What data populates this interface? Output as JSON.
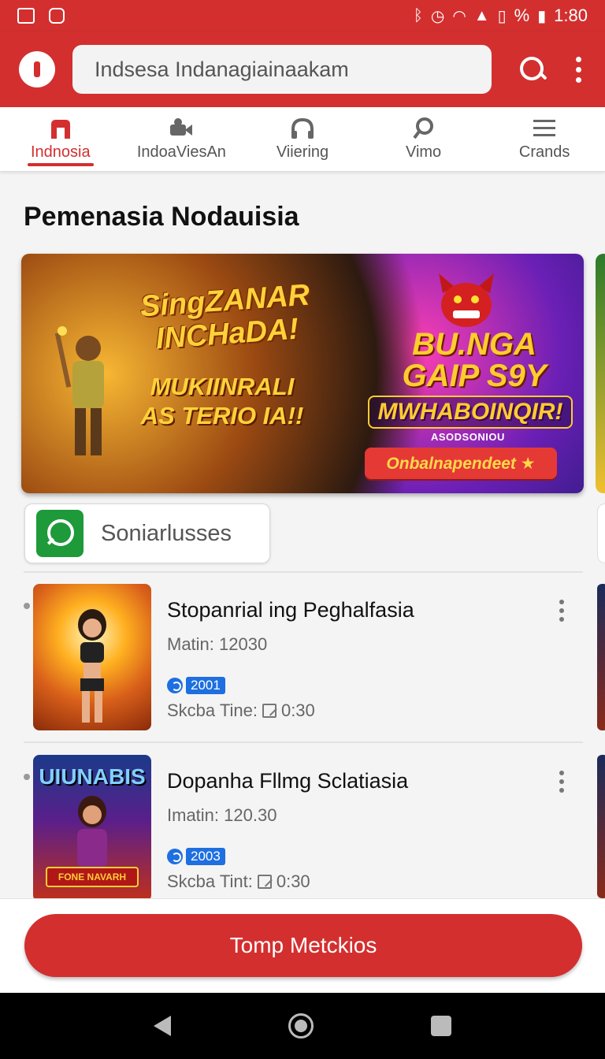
{
  "status_bar": {
    "time": "1:80",
    "battery": "%"
  },
  "app_bar": {
    "search_text": "Indsesa Indanagiainaakam"
  },
  "tabs": [
    {
      "label": "Indnosia",
      "icon": "home-icon",
      "active": true
    },
    {
      "label": "IndoaViesAn",
      "icon": "videocam-icon",
      "active": false
    },
    {
      "label": "Viiering",
      "icon": "headset-icon",
      "active": false
    },
    {
      "label": "Vimo",
      "icon": "search-icon",
      "active": false
    },
    {
      "label": "Crands",
      "icon": "menu-icon",
      "active": false
    }
  ],
  "section": {
    "title": "Pemenasia Nodauisia"
  },
  "banner": {
    "title": "SingZANAR INCHaDA!",
    "subtitle": "MUKIINRALI AS TERIO IA!!",
    "right_title": "BU.NGA GAIP S9Y",
    "right_subtitle": "MWHABOINQIR!",
    "right_tag": "ASODSONIOU",
    "cta": "Onbalnapendeet ★"
  },
  "chip": {
    "label": "Soniarlusses"
  },
  "items": [
    {
      "title": "Stopanrial ing Peghalfasia",
      "meta": "Matin: 12030",
      "badge": "2001",
      "time_label": "Skcba Tine:",
      "time_value": "0:30",
      "thumb_text": ""
    },
    {
      "title": "Dopanha Fllmg Sclatiasia",
      "meta": "Imatin: 120.30",
      "badge": "2003",
      "time_label": "Skcba Tint:",
      "time_value": "0:30",
      "thumb_text": "UIUNABIS",
      "thumb_banner": "FONE NAVARH"
    }
  ],
  "bottom_button": {
    "label": "Tomp Metckios"
  },
  "colors": {
    "primary": "#d32f2f",
    "badge": "#1e6fe0",
    "chip_icon": "#1e9a3a"
  }
}
